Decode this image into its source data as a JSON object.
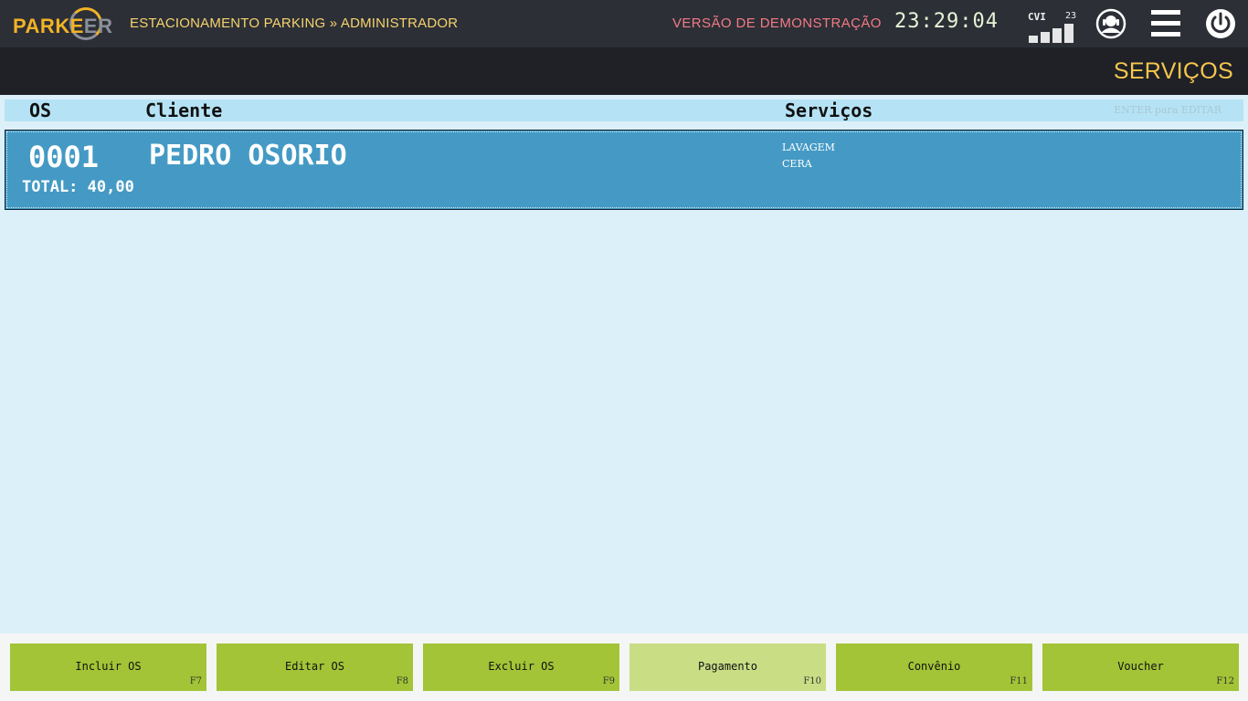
{
  "header": {
    "logo_text": "PARKEER",
    "breadcrumb": "ESTACIONAMENTO PARKING » ADMINISTRADOR",
    "demo_label": "VERSÃO DE DEMONSTRAÇÃO",
    "clock": "23:29:04",
    "signal": {
      "label": "CVI",
      "count": "23",
      "bars": 4
    },
    "icons": [
      "user-icon",
      "menu-icon",
      "power-icon"
    ]
  },
  "page": {
    "title": "SERVIÇOS"
  },
  "table": {
    "headers": {
      "os": "OS",
      "cliente": "Cliente",
      "servicos": "Serviços"
    },
    "hint": "ENTER para EDITAR",
    "rows": [
      {
        "os": "0001",
        "cliente": "PEDRO OSORIO",
        "total": "TOTAL: 40,00",
        "servicos": [
          "LAVAGEM",
          "CERA"
        ]
      }
    ]
  },
  "toolbar": {
    "buttons": [
      {
        "label": "Incluir OS",
        "key": "F7",
        "enabled": true
      },
      {
        "label": "Editar OS",
        "key": "F8",
        "enabled": true
      },
      {
        "label": "Excluir OS",
        "key": "F9",
        "enabled": true
      },
      {
        "label": "Pagamento",
        "key": "F10",
        "enabled": false
      },
      {
        "label": "Convênio",
        "key": "F11",
        "enabled": true
      },
      {
        "label": "Voucher",
        "key": "F12",
        "enabled": true
      }
    ]
  },
  "colors": {
    "topbar": "#2c2f36",
    "accent": "#f6c64e",
    "row_selected": "#449ac4",
    "button": "#a2c436",
    "button_disabled": "#c9dd85"
  }
}
